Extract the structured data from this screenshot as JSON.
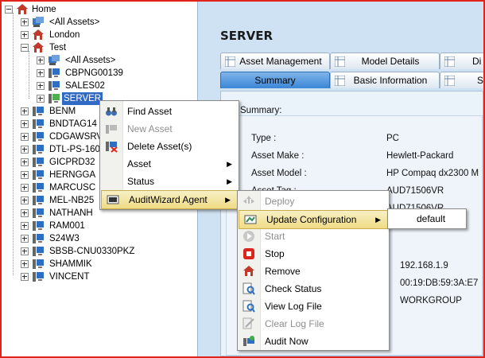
{
  "tree": {
    "home": "Home",
    "all_assets": "<All Assets>",
    "london": "London",
    "test": "Test",
    "test_children": [
      "<All Assets>",
      "CBPNG00139",
      "SALES02",
      "SERVER"
    ],
    "assets": [
      "BENM",
      "BNDTAG14",
      "CDGAWSRV",
      "DTL-PS-160",
      "GICPRD32",
      "HERNGGA",
      "MARCUSC",
      "MEL-NB25",
      "NATHANH",
      "RAM001",
      "S24W3",
      "SBSB-CNU0330PKZ",
      "SHAMMIK",
      "VINCENT"
    ]
  },
  "panel": {
    "title": "SERVER",
    "tabs_row1": [
      "Asset Management",
      "Model Details",
      "Di"
    ],
    "tabs_row2": [
      "Summary",
      "Basic Information",
      "S"
    ],
    "section_label": "Summary:",
    "fields": [
      {
        "label": "Type :",
        "value": "PC"
      },
      {
        "label": "Asset Make :",
        "value": "Hewlett-Packard"
      },
      {
        "label": "Asset Model :",
        "value": "HP Compaq dx2300 M"
      },
      {
        "label": "Asset Tag :",
        "value": "AUD71506VR"
      },
      {
        "label": "",
        "value": "AUD71506VR"
      }
    ],
    "partial_values": [
      "192.168.1.9",
      "00:19:DB:59:3A:E7",
      "WORKGROUP"
    ]
  },
  "context_menu": {
    "items": [
      {
        "label": "Find Asset",
        "icon": "binoculars-icon",
        "disabled": false
      },
      {
        "label": "New Asset",
        "icon": "new-asset-icon",
        "disabled": true
      },
      {
        "label": "Delete Asset(s)",
        "icon": "delete-asset-icon",
        "disabled": false
      },
      {
        "label": "Asset",
        "icon": "",
        "disabled": false,
        "submenu": true
      },
      {
        "label": "Status",
        "icon": "",
        "disabled": false,
        "submenu": true
      },
      {
        "label": "AuditWizard Agent",
        "icon": "agent-icon",
        "disabled": false,
        "submenu": true
      }
    ]
  },
  "agent_menu": {
    "items": [
      {
        "label": "Deploy",
        "icon": "deploy-icon",
        "disabled": true
      },
      {
        "label": "Update Configuration",
        "icon": "update-config-icon",
        "disabled": false,
        "submenu": true
      },
      {
        "label": "Start",
        "icon": "start-icon",
        "disabled": true
      },
      {
        "label": "Stop",
        "icon": "stop-icon",
        "disabled": false
      },
      {
        "label": "Remove",
        "icon": "remove-icon",
        "disabled": false
      },
      {
        "label": "Check Status",
        "icon": "check-status-icon",
        "disabled": false
      },
      {
        "label": "View Log File",
        "icon": "view-log-icon",
        "disabled": false
      },
      {
        "label": "Clear Log File",
        "icon": "clear-log-icon",
        "disabled": true
      },
      {
        "label": "Audit Now",
        "icon": "audit-now-icon",
        "disabled": false
      }
    ]
  },
  "config_menu": {
    "items": [
      "default"
    ]
  },
  "colors": {
    "selection": "#316ac5",
    "panel_bg": "#cfe2f3",
    "menu_highlight": "#f0dc85",
    "frame_border": "#e0241b"
  }
}
